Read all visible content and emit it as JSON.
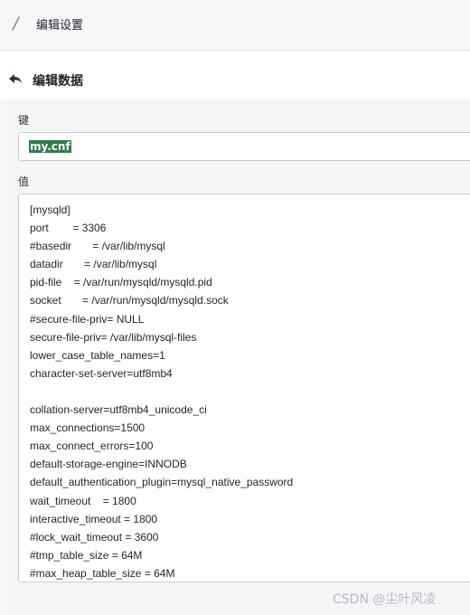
{
  "header": {
    "title": "编辑设置",
    "icon": "edit-pencil-icon"
  },
  "subheader": {
    "title": "编辑数据",
    "back_icon": "back-arrow-icon"
  },
  "form": {
    "key_label": "键",
    "key_value": "my.cnf",
    "value_label": "值",
    "value_content": "[mysqld]\nport        = 3306\n#basedir       = /var/lib/mysql\ndatadir       = /var/lib/mysql\npid-file    = /var/run/mysqld/mysqld.pid\nsocket       = /var/run/mysqld/mysqld.sock\n#secure-file-priv= NULL\nsecure-file-priv= /var/lib/mysql-files\nlower_case_table_names=1\ncharacter-set-server=utf8mb4\n\ncollation-server=utf8mb4_unicode_ci\nmax_connections=1500\nmax_connect_errors=100\ndefault-storage-engine=INNODB\ndefault_authentication_plugin=mysql_native_password\nwait_timeout    = 1800\ninteractive_timeout = 1800\n#lock_wait_timeout = 3600\n#tmp_table_size = 64M\n#max_heap_table_size = 64M"
  },
  "watermark": "CSDN @尘叶风凌"
}
